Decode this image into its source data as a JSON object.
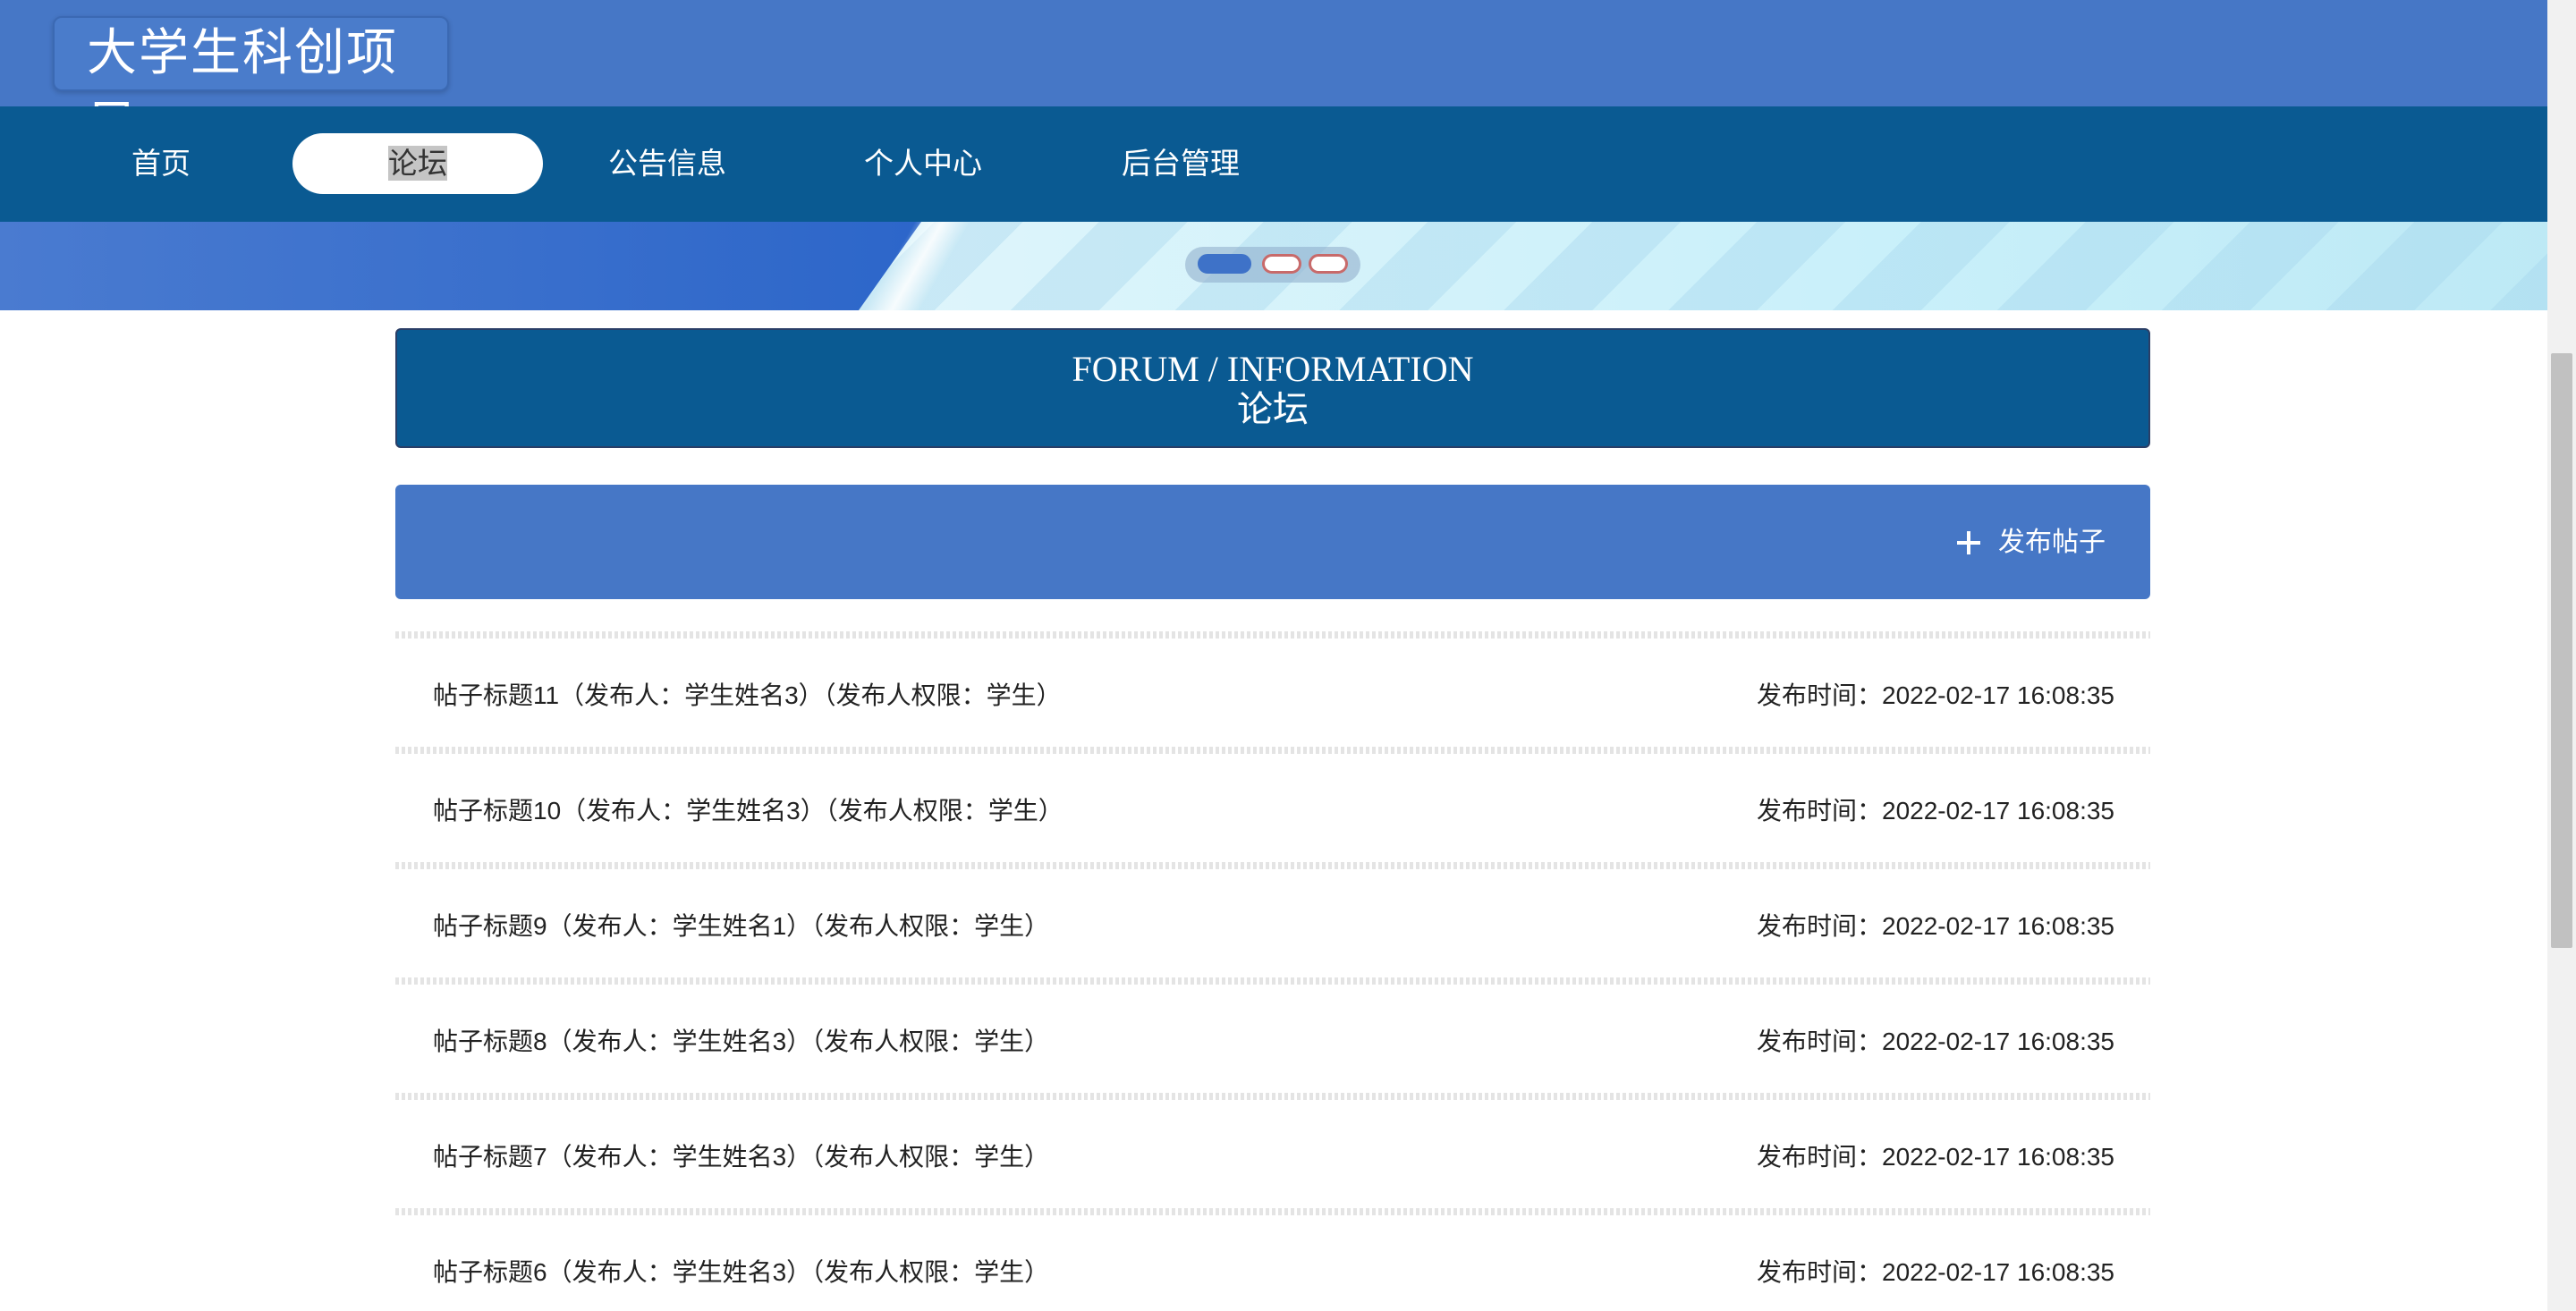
{
  "header": {
    "brand": "大学生科创项目"
  },
  "nav": {
    "items": [
      {
        "label": "首页"
      },
      {
        "label": "论坛"
      },
      {
        "label": "公告信息"
      },
      {
        "label": "个人中心"
      },
      {
        "label": "后台管理"
      }
    ],
    "active": "论坛"
  },
  "carousel": {
    "slide_count": 3,
    "active_slide": 1,
    "colors": {
      "active": "#3e72c8",
      "inactive_border": "#c86a6a"
    }
  },
  "section": {
    "title_en": "FORUM / INFORMATION",
    "title_cn": "论坛"
  },
  "toolbar": {
    "publish_label": "发布帖子",
    "publish_icon": "plus-icon"
  },
  "posts": [
    {
      "title": "帖子标题11（发布人：学生姓名3）（发布人权限：学生）",
      "time": "发布时间：2022-02-17 16:08:35"
    },
    {
      "title": "帖子标题10（发布人：学生姓名3）（发布人权限：学生）",
      "time": "发布时间：2022-02-17 16:08:35"
    },
    {
      "title": "帖子标题9（发布人：学生姓名1）（发布人权限：学生）",
      "time": "发布时间：2022-02-17 16:08:35"
    },
    {
      "title": "帖子标题8（发布人：学生姓名3）（发布人权限：学生）",
      "time": "发布时间：2022-02-17 16:08:35"
    },
    {
      "title": "帖子标题7（发布人：学生姓名3）（发布人权限：学生）",
      "time": "发布时间：2022-02-17 16:08:35"
    },
    {
      "title": "帖子标题6（发布人：学生姓名3）（发布人权限：学生）",
      "time": "发布时间：2022-02-17 16:08:35"
    }
  ],
  "theme": {
    "header_bg": "#4677c6",
    "nav_bg": "#0a5a92"
  }
}
